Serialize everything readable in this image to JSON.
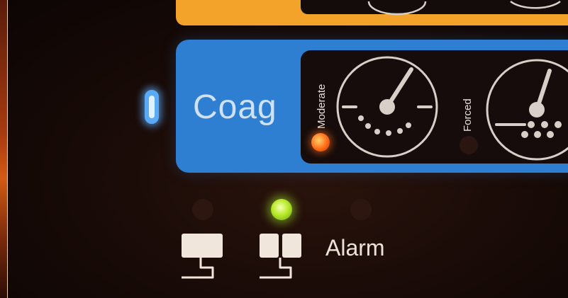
{
  "channel": {
    "label": "Coag"
  },
  "modes": [
    {
      "label": "Moderate",
      "led": "on",
      "led_color": "#ff6a17"
    },
    {
      "label": "Forced",
      "led": "off"
    }
  ],
  "footswitch": {
    "alarm_label": "Alarm",
    "indicators": [
      {
        "state": "off"
      },
      {
        "state": "on",
        "color": "#b8e92b"
      },
      {
        "state": "off"
      }
    ]
  },
  "colors": {
    "blue_panel": "#2e7fd1",
    "orange_panel": "#f3a32a",
    "background": "#170a07"
  }
}
